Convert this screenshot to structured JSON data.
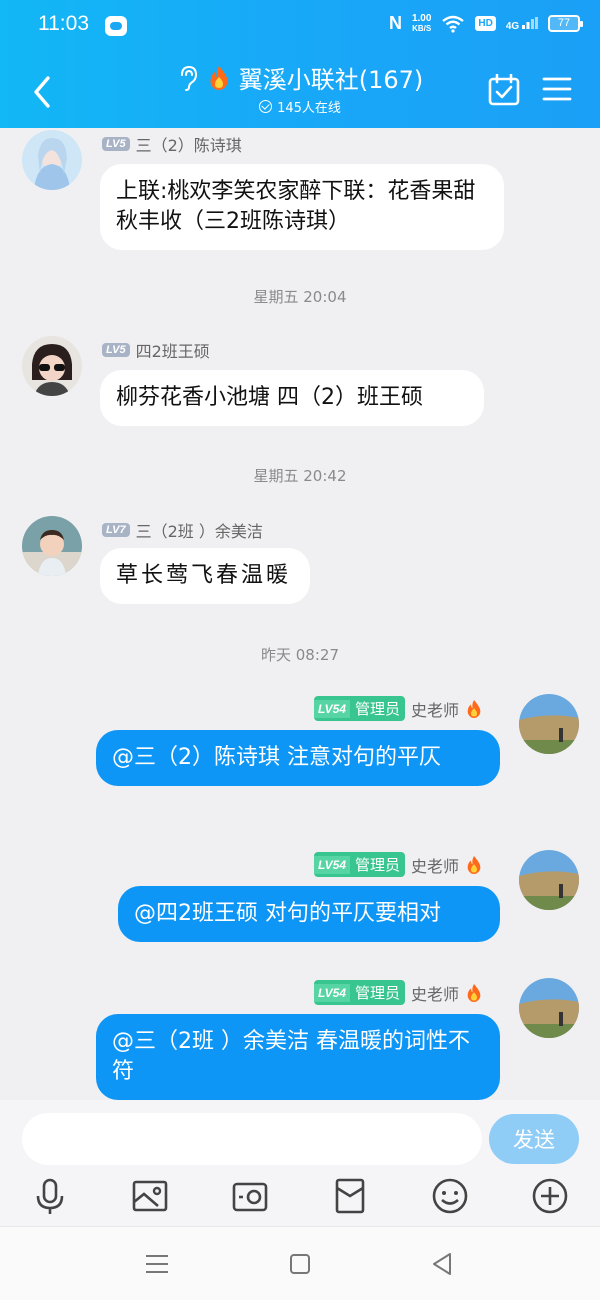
{
  "status_bar": {
    "time": "11:03",
    "network_speed_value": "1.00",
    "network_speed_unit": "KB/S",
    "hd_label": "HD",
    "signal_label": "4G",
    "battery": "77"
  },
  "header": {
    "title": "翼溪小联社(167)",
    "online": "145人在线",
    "accent_color": "#1aa8f6"
  },
  "messages": [
    {
      "sender_level": "LV5",
      "sender_name": "三（2）陈诗琪",
      "text": "上联:桃欢李笑农家醉下联：花香果甜秋丰收（三2班陈诗琪）"
    },
    {
      "timestamp": "星期五 20:04"
    },
    {
      "sender_level": "LV5",
      "sender_name": "四2班王硕",
      "text": "柳芬花香小池塘 四（2）班王硕"
    },
    {
      "timestamp": "星期五 20:42"
    },
    {
      "sender_level": "LV7",
      "sender_name": "三（2班 ）余美洁",
      "text": "草长莺飞春温暖"
    },
    {
      "timestamp": "昨天 08:27"
    },
    {
      "sender_level": "LV54",
      "sender_role": "管理员",
      "sender_name": "史老师",
      "text": "@三（2）陈诗琪 注意对句的平仄"
    },
    {
      "sender_level": "LV54",
      "sender_role": "管理员",
      "sender_name": "史老师",
      "text": "@四2班王硕 对句的平仄要相对"
    },
    {
      "sender_level": "LV54",
      "sender_role": "管理员",
      "sender_name": "史老师",
      "text": "@三（2班 ）余美洁 春温暖的词性不符"
    }
  ],
  "input": {
    "placeholder": "",
    "value": "",
    "send_label": "发送"
  },
  "toolbar": {
    "icons": [
      "microphone-icon",
      "image-icon",
      "camera-icon",
      "red-packet-icon",
      "emoji-icon",
      "plus-icon"
    ]
  },
  "colors": {
    "bubble_self": "#0e96f7",
    "bubble_other": "#ffffff",
    "admin_badge": "#39c58f",
    "send_button": "#8fcdf7"
  }
}
